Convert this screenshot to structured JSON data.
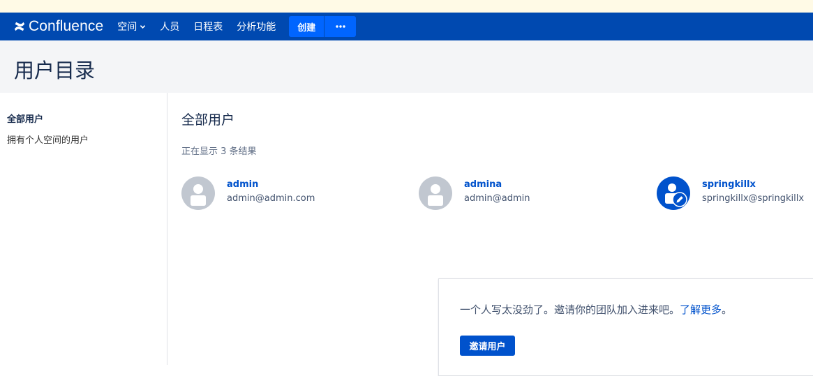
{
  "navbar": {
    "logo_text": "Confluence",
    "items": [
      {
        "label": "空间",
        "has_dropdown": true
      },
      {
        "label": "人员"
      },
      {
        "label": "日程表"
      },
      {
        "label": "分析功能"
      }
    ],
    "create_label": "创建",
    "more_label": "•••",
    "colors": {
      "bar": "#0049b0",
      "button": "#0065ff"
    }
  },
  "header": {
    "title": "用户目录"
  },
  "sidebar": {
    "items": [
      {
        "label": "全部用户",
        "active": true
      },
      {
        "label": "拥有个人空间的用户"
      }
    ]
  },
  "main": {
    "title": "全部用户",
    "result_count": "正在显示 3 条结果",
    "users": [
      {
        "name": "admin",
        "email": "admin@admin.com",
        "avatar": "default-avatar-icon"
      },
      {
        "name": "admina",
        "email": "admin@admin",
        "avatar": "default-avatar-icon"
      },
      {
        "name": "springkillx",
        "email": "springkillx@springkillx",
        "avatar": "edit-avatar-icon"
      }
    ]
  },
  "invite": {
    "text": "一个人写太没劲了。邀请你的团队加入进来吧。",
    "link_text": "了解更多",
    "suffix": "。",
    "button_label": "邀请用户"
  }
}
